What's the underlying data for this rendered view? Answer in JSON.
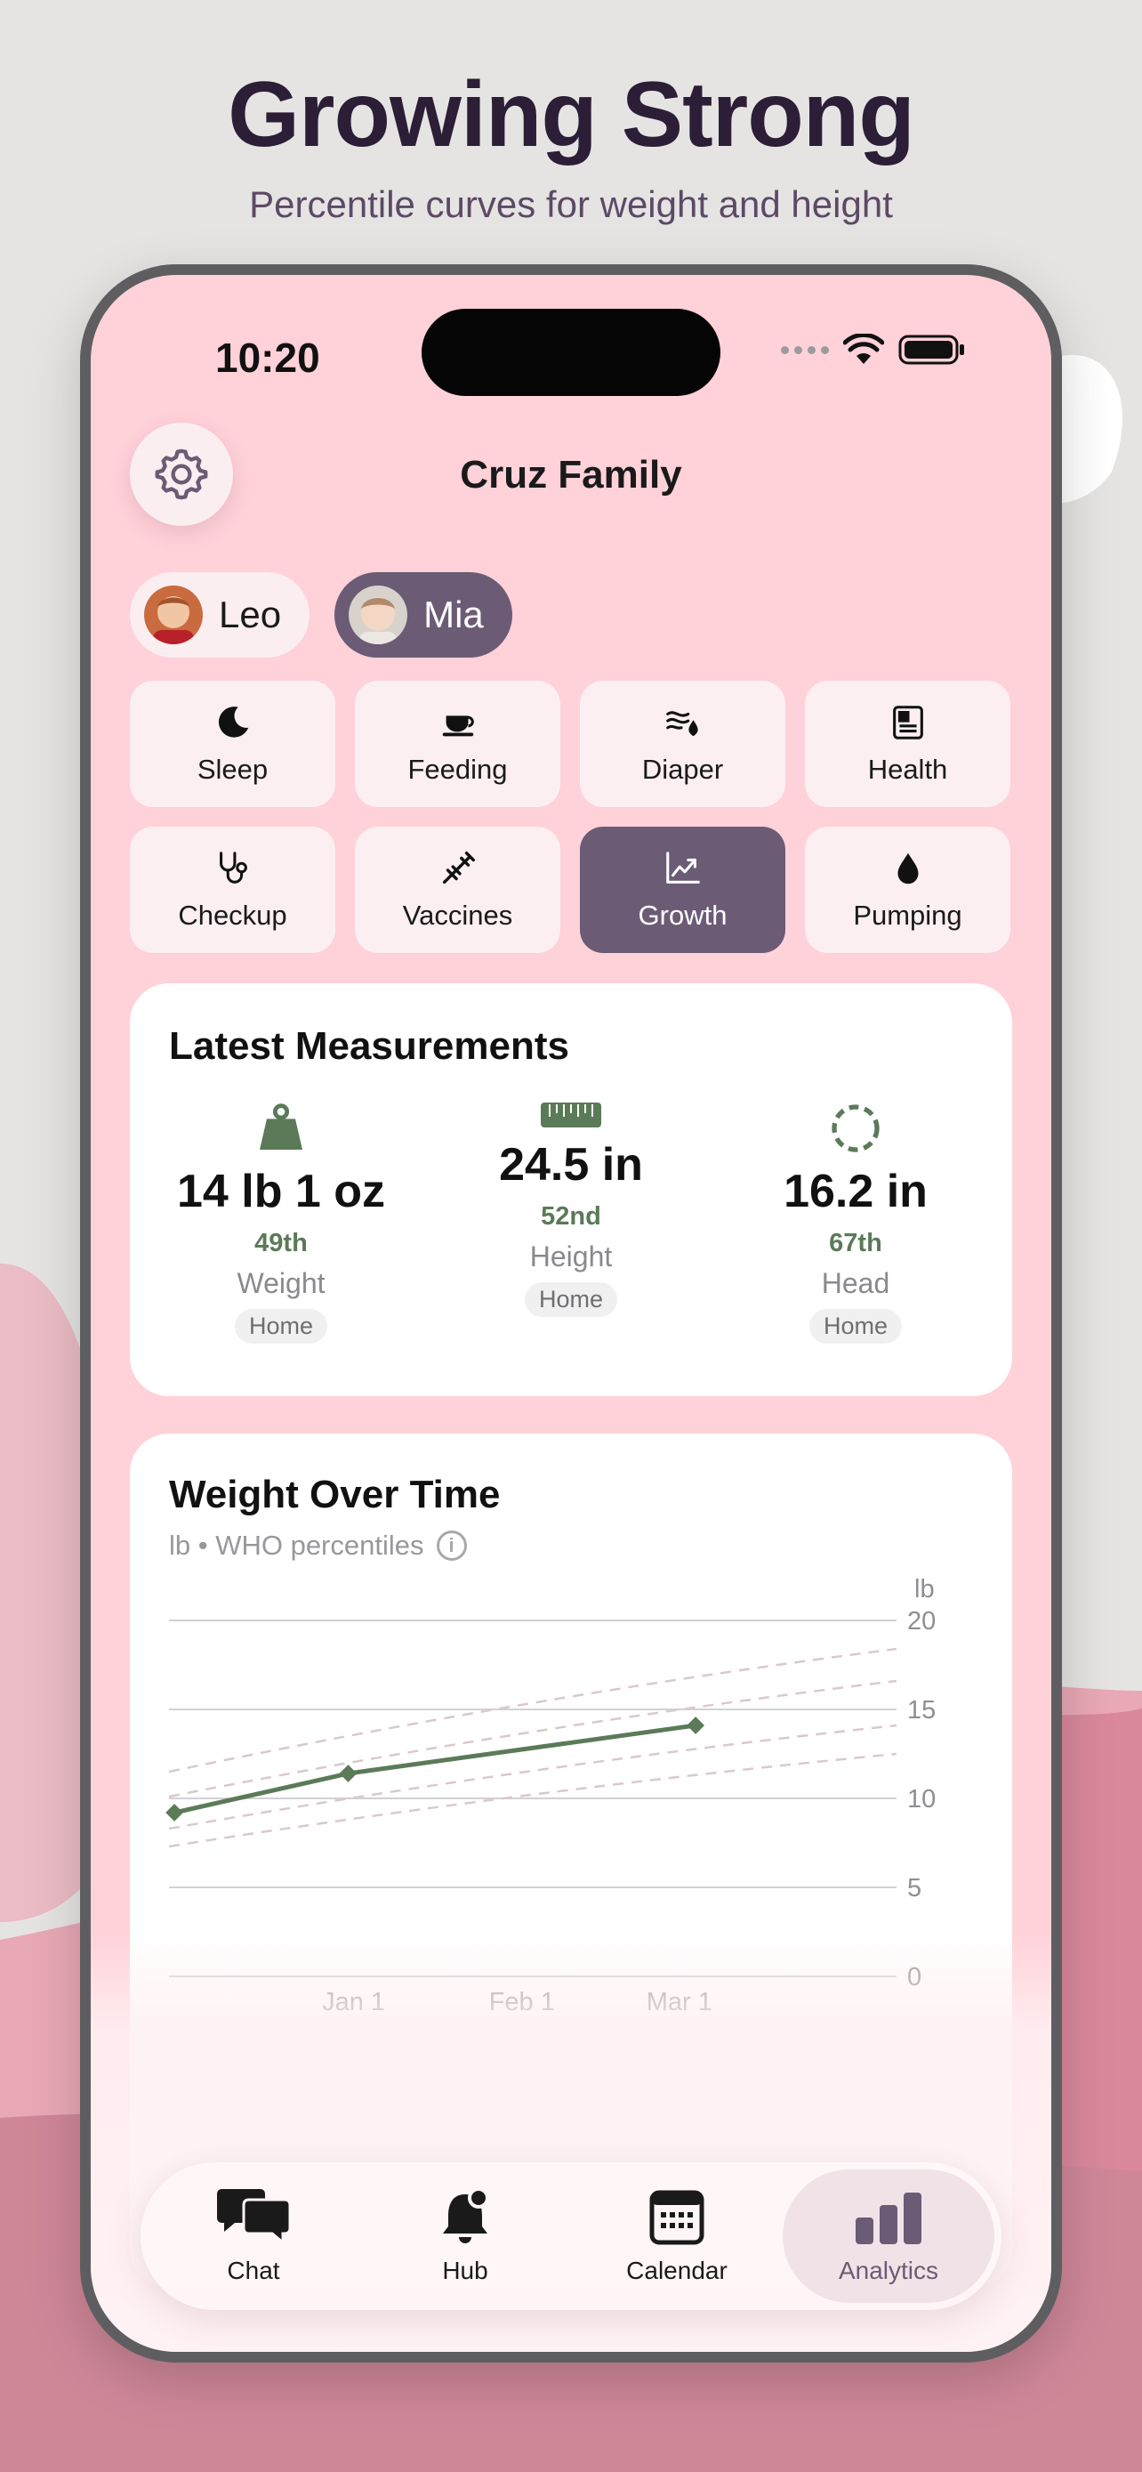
{
  "promo": {
    "title": "Growing Strong",
    "subtitle": "Percentile curves for weight and height"
  },
  "status_bar": {
    "time": "10:20"
  },
  "header": {
    "family_name": "Cruz Family",
    "settings_icon": "gear-icon"
  },
  "children": [
    {
      "name": "Leo",
      "active": false
    },
    {
      "name": "Mia",
      "active": true
    }
  ],
  "categories": [
    {
      "label": "Sleep",
      "icon": "moon-icon"
    },
    {
      "label": "Feeding",
      "icon": "cup-icon"
    },
    {
      "label": "Diaper",
      "icon": "diaper-icon"
    },
    {
      "label": "Health",
      "icon": "health-record-icon"
    },
    {
      "label": "Checkup",
      "icon": "stethoscope-icon"
    },
    {
      "label": "Vaccines",
      "icon": "syringe-icon"
    },
    {
      "label": "Growth",
      "icon": "growth-chart-icon",
      "active": true
    },
    {
      "label": "Pumping",
      "icon": "drop-icon"
    }
  ],
  "latest_measurements": {
    "title": "Latest Measurements",
    "items": [
      {
        "value": "14 lb 1 oz",
        "percentile": "49th",
        "label": "Weight",
        "source": "Home",
        "icon": "weight-icon"
      },
      {
        "value": "24.5 in",
        "percentile": "52nd",
        "label": "Height",
        "source": "Home",
        "icon": "ruler-icon"
      },
      {
        "value": "16.2 in",
        "percentile": "67th",
        "label": "Head",
        "source": "Home",
        "icon": "head-circle-icon"
      }
    ]
  },
  "weight_chart": {
    "title": "Weight Over Time",
    "subtitle": "lb • WHO percentiles",
    "accent_color": "#5b7a58",
    "percentile_color": "#d9c9cc"
  },
  "chart_data": {
    "type": "line",
    "title": "Weight Over Time",
    "ylabel": "lb",
    "ylim": [
      0,
      20
    ],
    "yticks": [
      "20",
      "15",
      "10",
      "5",
      "0"
    ],
    "xticks": [
      "Jan 1",
      "Feb 1",
      "Mar 1"
    ],
    "x": [
      "2023-11-29",
      "2023-12-31",
      "2024-03-04"
    ],
    "series": [
      {
        "values": [
          9.2,
          11.4,
          14.1
        ]
      }
    ],
    "percentile_curves": [
      {
        "values_start": 7.3,
        "values_end": 12.5
      },
      {
        "values_start": 8.3,
        "values_end": 14.1
      },
      {
        "values_start": 10.1,
        "values_end": 16.6
      },
      {
        "values_start": 11.5,
        "values_end": 18.4
      }
    ],
    "grid": true
  },
  "tab_bar": [
    {
      "label": "Chat",
      "icon": "chat-bubbles-icon"
    },
    {
      "label": "Hub",
      "icon": "bell-icon"
    },
    {
      "label": "Calendar",
      "icon": "calendar-icon"
    },
    {
      "label": "Analytics",
      "icon": "bar-chart-icon",
      "active": true
    }
  ]
}
